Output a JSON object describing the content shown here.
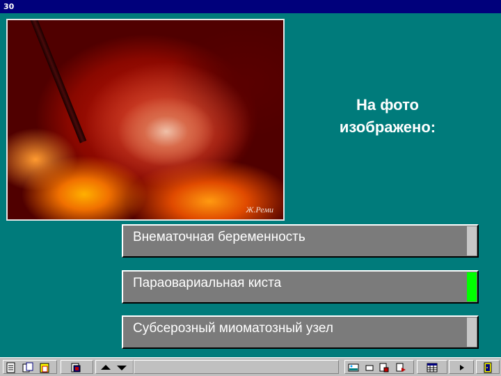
{
  "window": {
    "title": "30"
  },
  "question": {
    "line1": "На фото",
    "line2": "изображено:"
  },
  "answers": [
    {
      "label": "Внематочная беременность",
      "indicator": "gray"
    },
    {
      "label": "Параовариальная киста",
      "indicator": "green"
    },
    {
      "label": "Субсерозный миоматозный узел",
      "indicator": "gray"
    }
  ],
  "colors": {
    "background": "#007b7b",
    "answer_bg": "#7b7b7b",
    "selected_indicator": "#00ff00",
    "titlebar": "#00007b"
  },
  "toolbar": {
    "icons": [
      "document-icon",
      "copy-icon",
      "paste-icon",
      "bookmark-icon",
      "arrow-up-icon",
      "arrow-down-icon",
      "picture-icon",
      "window-icon",
      "edit-icon",
      "export-icon",
      "calendar-icon",
      "play-icon",
      "exit-icon"
    ]
  }
}
